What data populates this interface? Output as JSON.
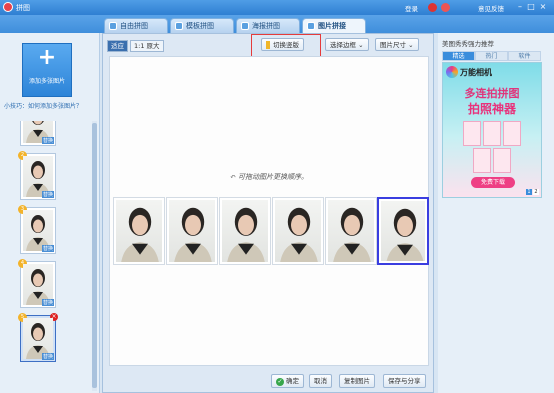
{
  "window": {
    "title": "拼图",
    "login_label": "登录",
    "feedback_label": "意见反馈"
  },
  "tabs": [
    {
      "label": "自由拼图",
      "active": false
    },
    {
      "label": "模板拼图",
      "active": false
    },
    {
      "label": "海报拼图",
      "active": false
    },
    {
      "label": "图片拼接",
      "active": true
    }
  ],
  "left": {
    "add_button": {
      "icon": "plus-icon",
      "label": "添加多张图片"
    },
    "tip": "小技巧：如何添加多张图片？",
    "thumbnails": [
      {
        "index": "",
        "replace": "替换"
      },
      {
        "index": "2",
        "replace": "替换"
      },
      {
        "index": "3",
        "replace": "替换"
      },
      {
        "index": "4",
        "replace": "替换"
      },
      {
        "index": "5",
        "replace": "替换",
        "selected": true
      }
    ]
  },
  "canvas_toolbar": {
    "zoom_options": [
      {
        "label": "适应",
        "active": true
      },
      {
        "label": "1:1 原大",
        "active": false
      }
    ],
    "switch_layout_label": "切换竖版",
    "select_border_label": "选择边框",
    "image_size_label": "图片尺寸"
  },
  "canvas": {
    "hint": "↶ 可拖动图片更换顺序。",
    "photo_count": 6,
    "selected_photo_index": 6
  },
  "bottom_buttons": {
    "confirm": "确定",
    "cancel": "取消",
    "copy": "复制图片",
    "save": "保存与分享"
  },
  "right": {
    "title": "美图秀秀强力推荐",
    "tabs": [
      {
        "label": "精选",
        "active": true
      },
      {
        "label": "热门",
        "active": false
      },
      {
        "label": "软件",
        "active": false
      }
    ],
    "ad": {
      "brand": "万能相机",
      "line1": "多连拍拼图",
      "line2": "拍照神器",
      "cta": "免费下载",
      "pager": [
        "1",
        "2"
      ]
    }
  },
  "colors": {
    "accent": "#2f7fd2",
    "highlight_box": "#e53b3b",
    "selected_border": "#3a3ee0"
  }
}
